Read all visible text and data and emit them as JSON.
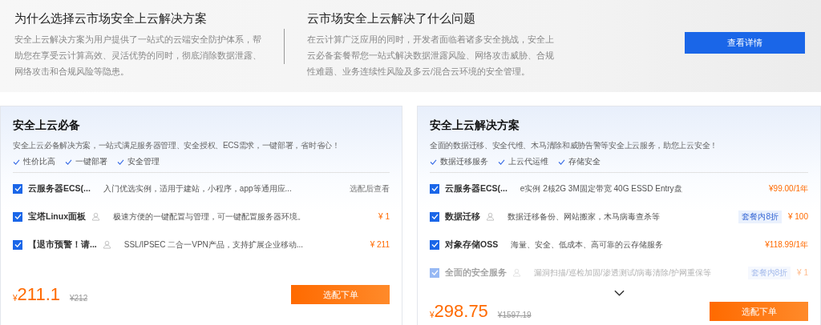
{
  "intro": {
    "columns": [
      {
        "title": "为什么选择云市场安全上云解决方案",
        "text": "安全上云解决方案为用户提供了一站式的云端安全防护体系，帮助您在享受云计算高效、灵活优势的同时，彻底消除数据泄露、网络攻击和合规风险等隐患。"
      },
      {
        "title": "云市场安全上云解决了什么问题",
        "text": "在云计算广泛应用的同时，开发者面临着诸多安全挑战，安全上云必备套餐帮您一站式解决数据泄露风险、网络攻击威胁、合规性难题、业务连续性风险及多云/混合云环境的安全管理。"
      }
    ],
    "button": "查看详情"
  },
  "cards": [
    {
      "title": "安全上云必备",
      "description": "安全上云必备解决方案，一站式满足服务器管理、安全授权、ECS需求，一键部署，省时省心！",
      "features": [
        "性价比高",
        "一键部署",
        "安全管理"
      ],
      "items": [
        {
          "name": "云服务器ECS(...",
          "has_icon": false,
          "desc": "入门优选实例，适用于建站，小程序，app等通用应...",
          "price": "选配后查看",
          "price_muted": true,
          "checked": true,
          "faded": false
        },
        {
          "name": "宝塔Linux面板",
          "has_icon": true,
          "desc": "极速方便的一键配置与管理，可一键配置服务器环境。",
          "price": "¥ 1",
          "price_muted": false,
          "checked": true,
          "faded": false
        },
        {
          "name": "【退市预警！请...",
          "has_icon": true,
          "desc": "SSL/IPSEC 二合一VPN产品，支持扩展企业移动...",
          "price": "¥ 211",
          "price_muted": false,
          "checked": true,
          "faded": false
        }
      ],
      "more": false,
      "currency": "¥",
      "total": "211.1",
      "original": "¥212",
      "button": "选配下单"
    },
    {
      "title": "安全上云解决方案",
      "description": "全面的数据迁移、安全代维、木马清除和威胁告警等安全上云服务，助您上云安全！",
      "features": [
        "数据迁移服务",
        "上云代运维",
        "存储安全"
      ],
      "items": [
        {
          "name": "云服务器ECS(...",
          "has_icon": false,
          "desc": "e实例 2核2G 3M固定带宽 40G ESSD Entry盘",
          "price": "¥99.00/1年",
          "price_muted": false,
          "checked": true,
          "faded": false
        },
        {
          "name": "数据迁移",
          "has_icon": true,
          "desc": "数据迁移备份、网站搬家，木马病毒查杀等",
          "badge": "套餐内8折",
          "price": "¥ 100",
          "price_muted": false,
          "checked": true,
          "faded": false
        },
        {
          "name": "对象存储OSS",
          "has_icon": false,
          "desc": "海量、安全、低成本、高可靠的云存储服务",
          "price": "¥118.99/1年",
          "price_muted": false,
          "checked": true,
          "faded": false
        },
        {
          "name": "全面的安全服务",
          "has_icon": true,
          "desc": "漏洞扫描/巡检加固/渗透测试/病毒清除/护网重保等",
          "badge": "套餐内8折",
          "price": "¥ 1",
          "price_muted": false,
          "checked": true,
          "faded": true
        }
      ],
      "more": true,
      "currency": "¥",
      "total": "298.75",
      "original": "¥1597.19",
      "button": "选配下单"
    }
  ]
}
